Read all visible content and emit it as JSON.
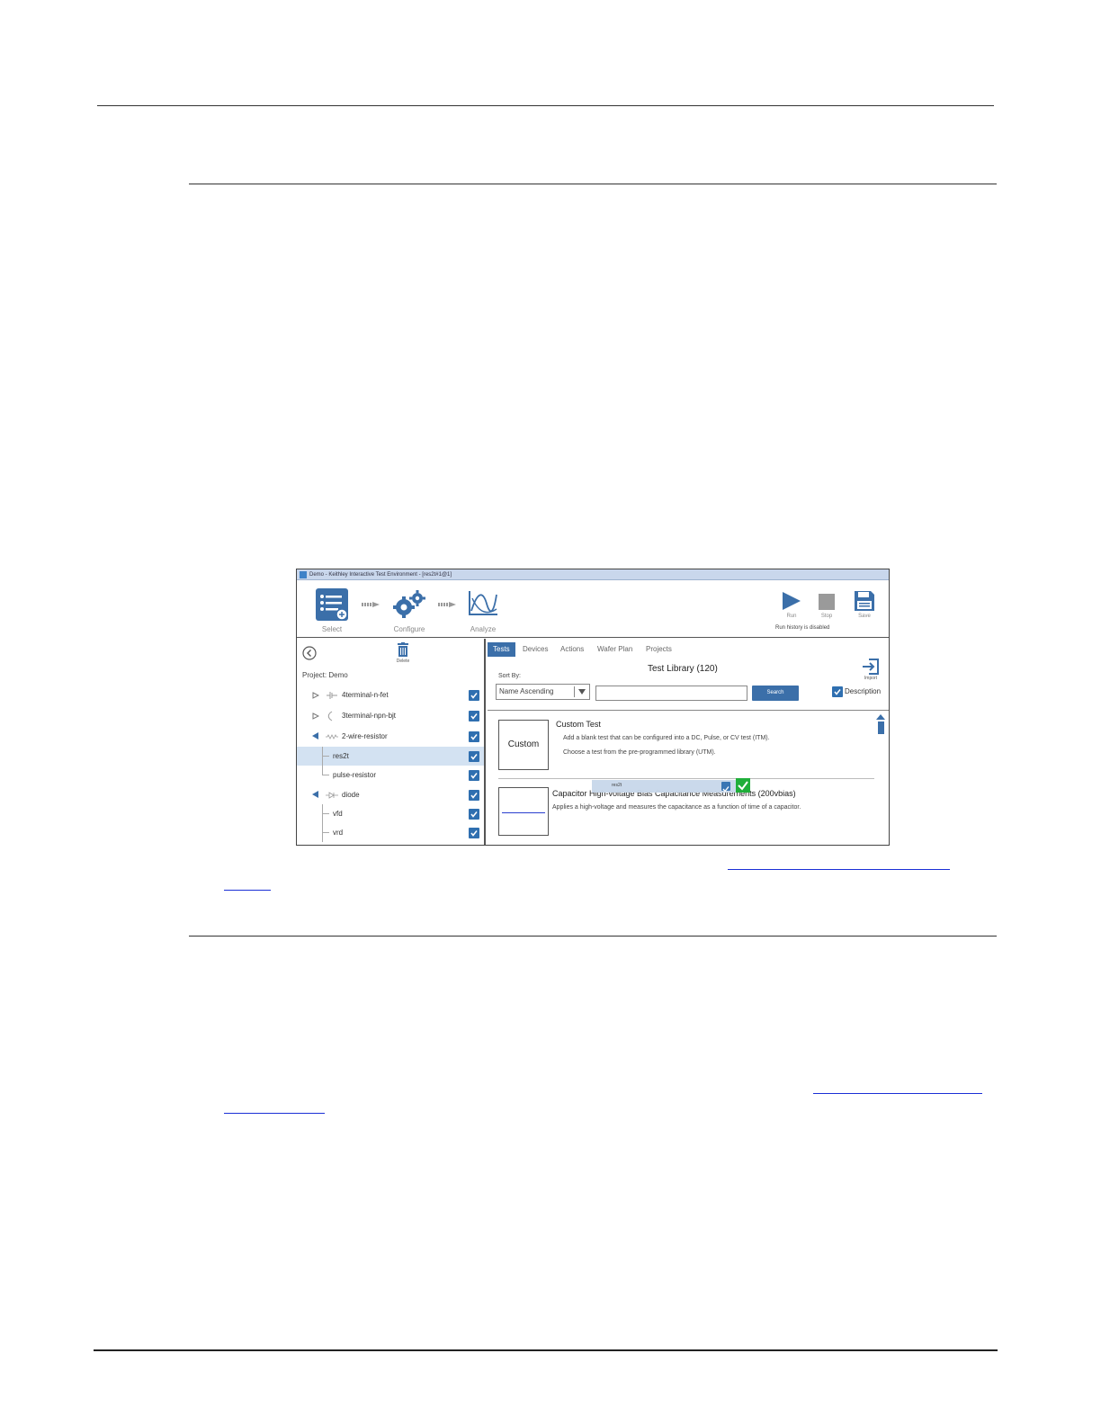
{
  "window": {
    "title": "Demo - Keithley Interactive Test Environment - [res2t#1@1]"
  },
  "toolbar": {
    "select_label": "Select",
    "configure_label": "Configure",
    "analyze_label": "Analyze",
    "run_label": "Run",
    "stop_label": "Stop",
    "save_label": "Save",
    "run_history_text": "Run history is disabled"
  },
  "left": {
    "delete_label": "Delete",
    "project_label": "Project: Demo",
    "items": [
      {
        "label": "4terminal-n-fet"
      },
      {
        "label": "3terminal-npn-bjt"
      },
      {
        "label": "2-wire-resistor"
      },
      {
        "label": "res2t"
      },
      {
        "label": "pulse-resistor"
      },
      {
        "label": "diode"
      },
      {
        "label": "vfd"
      },
      {
        "label": "vrd"
      }
    ]
  },
  "right": {
    "tabs": [
      "Tests",
      "Devices",
      "Actions",
      "Wafer Plan",
      "Projects"
    ],
    "library_title": "Test Library (120)",
    "import_label": "Import",
    "sort_by_label": "Sort By:",
    "sort_value": "Name Ascending",
    "search_label": "Search",
    "description_label": "Description",
    "cards": [
      {
        "thumb_text": "Custom",
        "title": "Custom Test",
        "line1": "Add a blank test that can be configured into a DC, Pulse, or CV test (ITM).",
        "line2": "Choose a test from the pre-programmed library (UTM)."
      },
      {
        "title": "Capacitor High-voltage Bias Capacitance Measurements (200vbias)",
        "line1": "Applies a high-voltage and measures the capacitance as a function of time of a capacitor."
      }
    ],
    "drag_item": "res2t"
  },
  "colors": {
    "accent": "#3b6fa9",
    "selected_row": "#d3e2f2",
    "drop_ok": "#1fae3a",
    "link": "#1a2fd6"
  }
}
